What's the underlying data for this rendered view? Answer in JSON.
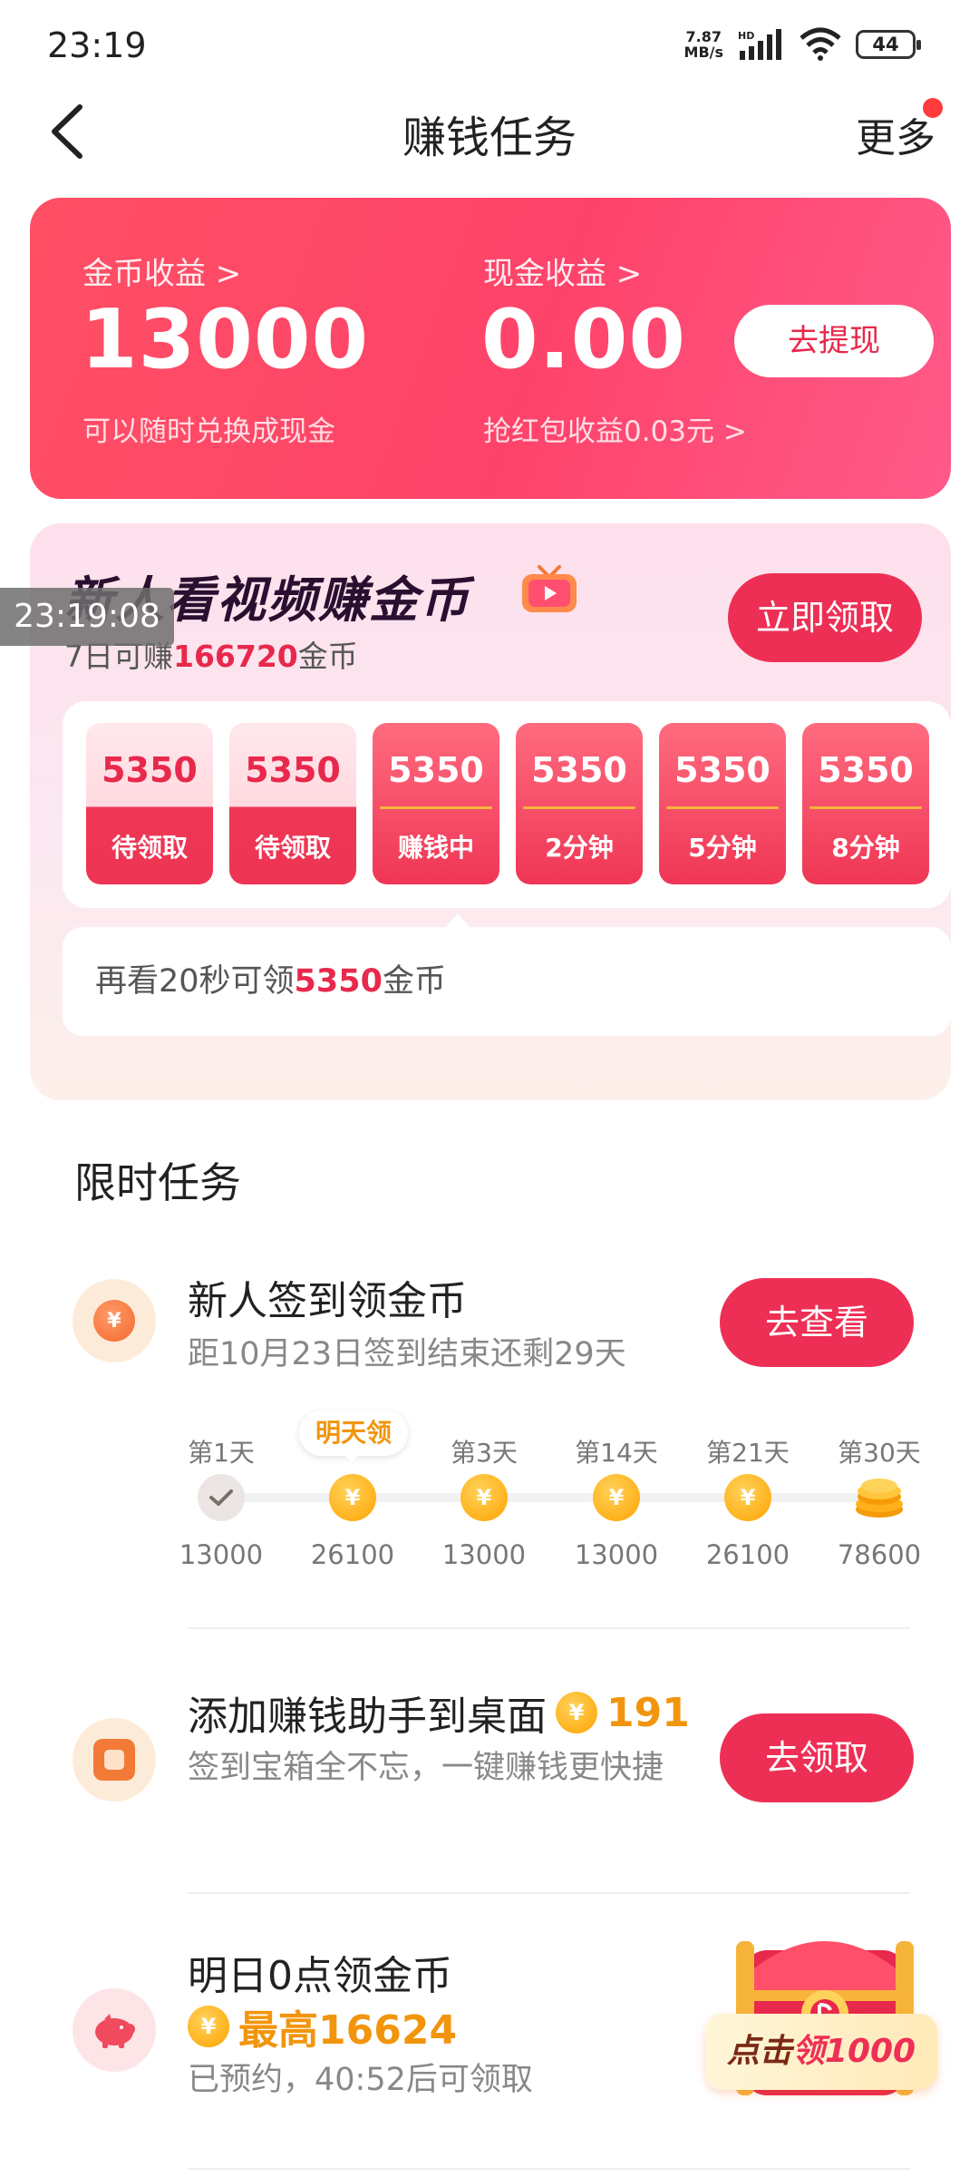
{
  "status_bar": {
    "time": "23:19",
    "speed_value": "7.87",
    "speed_unit": "MB/s",
    "network": "HD",
    "battery": "44"
  },
  "header": {
    "title": "赚钱任务",
    "more_label": "更多"
  },
  "earnings": {
    "coin_label": "金币收益 >",
    "coin_value": "13000",
    "coin_sub": "可以随时兑换成现金",
    "cash_label": "现金收益 >",
    "cash_value": "0.00",
    "cash_sub": "抢红包收益0.03元 >",
    "withdraw_label": "去提现"
  },
  "video_card": {
    "title": "新人看视频赚金币",
    "sub_prefix": "7日可赚",
    "sub_amount": "166720",
    "sub_suffix": "金币",
    "claim_label": "立即领取",
    "overlay_time": "23:19:08",
    "rewards": [
      {
        "amount": "5350",
        "label": "待领取",
        "state": "pending"
      },
      {
        "amount": "5350",
        "label": "待领取",
        "state": "pending"
      },
      {
        "amount": "5350",
        "label": "赚钱中",
        "state": "active"
      },
      {
        "amount": "5350",
        "label": "2分钟",
        "state": "locked"
      },
      {
        "amount": "5350",
        "label": "5分钟",
        "state": "locked"
      },
      {
        "amount": "5350",
        "label": "8分钟",
        "state": "locked"
      }
    ],
    "hint_prefix": "再看20秒可领",
    "hint_amount": "5350",
    "hint_suffix": "金币"
  },
  "limited_tasks": {
    "title": "限时任务",
    "signin": {
      "title": "新人签到领金币",
      "desc": "距10月23日签到结束还剩29天",
      "button": "去查看",
      "tomorrow_bubble": "明天领",
      "days": [
        "第1天",
        "",
        "第3天",
        "第14天",
        "第21天",
        "第30天"
      ],
      "amounts": [
        "13000",
        "26100",
        "13000",
        "13000",
        "26100",
        "78600"
      ]
    },
    "desktop": {
      "title": "添加赚钱助手到桌面",
      "bonus": "191",
      "desc": "签到宝箱全不忘，一键赚钱更快捷",
      "button": "去领取"
    },
    "tomorrow": {
      "title": "明日0点领金币",
      "bonus": "最高16624",
      "desc": "已预约，40:52后可领取",
      "chest_prefix": "点击",
      "chest_highlight": "领1000"
    }
  },
  "colors": {
    "accent": "#ee2f55",
    "coin": "#f2950c"
  }
}
